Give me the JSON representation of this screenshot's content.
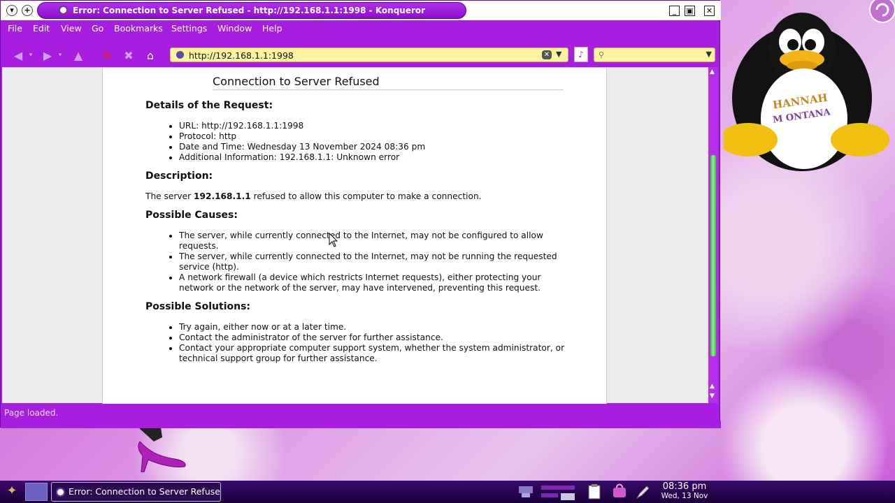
{
  "window": {
    "title": "Error: Connection to Server Refused - http://192.168.1.1:1998 - Konqueror"
  },
  "menu": [
    "File",
    "Edit",
    "View",
    "Go",
    "Bookmarks",
    "Settings",
    "Window",
    "Help"
  ],
  "toolbar": {
    "url": "http://192.168.1.1:1998"
  },
  "page": {
    "heading": "Connection to Server Refused",
    "details_title": "Details of the Request:",
    "details": [
      "URL: http://192.168.1.1:1998",
      "Protocol: http",
      "Date and Time: Wednesday 13 November 2024 08:36 pm",
      "Additional Information: 192.168.1.1: Unknown error"
    ],
    "description_title": "Description:",
    "description_prefix": "The server ",
    "description_server": "192.168.1.1",
    "description_suffix": " refused to allow this computer to make a connection.",
    "causes_title": "Possible Causes:",
    "causes": [
      "The server, while currently connected to the Internet, may not be configured to allow requests.",
      "The server, while currently connected to the Internet, may not be running the requested service (http).",
      "A network firewall (a device which restricts Internet requests), either protecting your network or the network of the server, may have intervened, preventing this request."
    ],
    "solutions_title": "Possible Solutions:",
    "solutions": [
      "Try again, either now or at a later time.",
      "Contact the administrator of the server for further assistance.",
      "Contact your appropriate computer support system, whether the system administrator, or technical support group for further assistance."
    ]
  },
  "status": "Page loaded.",
  "taskbar": {
    "task_label": "Error: Connection to Server Refused",
    "time": "08:36 pm",
    "date": "Wed, 13 Nov"
  },
  "decor": {
    "penguin_shirt_text": "HANNAH MONTANA"
  },
  "colors": {
    "window_accent": "#a81ee0",
    "url_field": "#fdf3a0",
    "scroll_thumb": "#34c23a"
  }
}
